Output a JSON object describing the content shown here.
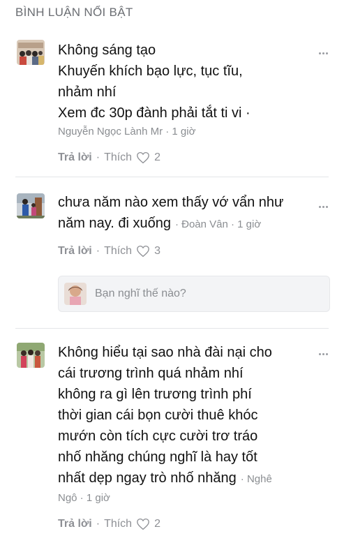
{
  "section_title": "BÌNH LUẬN NỔI BẬT",
  "colors": {
    "text": "#111111",
    "muted": "#8a8d91",
    "divider": "#e4e5e8",
    "reply_box_bg": "#f3f4f6"
  },
  "icons": {
    "more": "more-dots-icon",
    "like": "heart-outline-icon"
  },
  "comments": [
    {
      "lines": [
        "Không sáng tạo",
        "Khuyến khích bạo lực, tục tĩu,",
        "nhảm nhí",
        "Xem đc 30p đành phải tắt ti vi ·"
      ],
      "author_time": "Nguyễn Ngọc Lành Mr · 1 giờ",
      "reply_label": "Trả lời",
      "like_label": "Thích",
      "like_count": "2"
    },
    {
      "lines": [
        "chưa năm nào xem thấy vớ vẩn như",
        "năm nay. đi xuống"
      ],
      "author_time": "· Đoàn Vân · 1 giờ",
      "reply_label": "Trả lời",
      "like_label": "Thích",
      "like_count": "3"
    },
    {
      "lines": [
        "Không hiểu tại sao nhà đài nại cho",
        "cái trương trình quá nhảm nhí",
        "không ra gì lên trương trình phí",
        "thời gian cái bọn cười thuê khóc",
        "mướn còn tích cực cười trơ tráo",
        "nhố nhăng chúng nghĩ là hay tốt",
        "nhất dẹp ngay trò nhố nhăng"
      ],
      "author_inline": "· Nghê",
      "author_time": "Ngô · 1 giờ",
      "reply_label": "Trả lời",
      "like_label": "Thích",
      "like_count": "2"
    }
  ],
  "reply_box": {
    "placeholder": "Bạn nghĩ thế nào?"
  }
}
